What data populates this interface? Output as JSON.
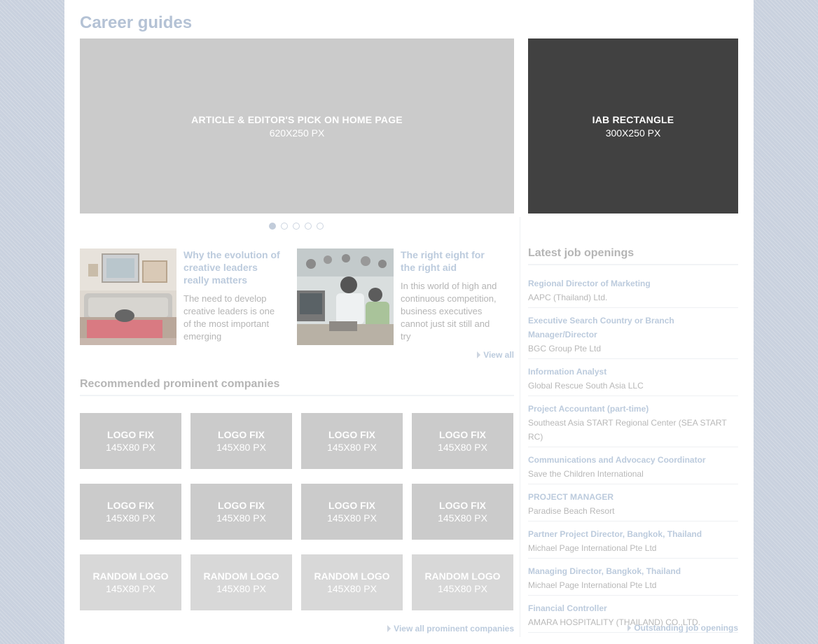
{
  "page": {
    "title": "Career guides"
  },
  "banner": {
    "line1": "ARTICLE & EDITOR'S PICK ON HOME PAGE",
    "line2": "620X250 PX"
  },
  "iab": {
    "line1": "IAB RECTANGLE",
    "line2": "300X250 PX"
  },
  "carousel": {
    "dot_count": 5,
    "active_index": 0
  },
  "articles": [
    {
      "title": "Why the evolution of creative leaders really matters",
      "excerpt": "The need to develop creative leaders is one of the most important emerging"
    },
    {
      "title": "The right eight for the right aid",
      "excerpt": "In this world of high and continuous competition, business executives cannot just sit still and try"
    }
  ],
  "articles_view_all": "View all",
  "recommended": {
    "title": "Recommended prominent companies",
    "logos": [
      {
        "line1": "LOGO FIX",
        "line2": "145X80 PX"
      },
      {
        "line1": "LOGO FIX",
        "line2": "145X80 PX"
      },
      {
        "line1": "LOGO FIX",
        "line2": "145X80 PX"
      },
      {
        "line1": "LOGO FIX",
        "line2": "145X80 PX"
      },
      {
        "line1": "LOGO FIX",
        "line2": "145X80 PX"
      },
      {
        "line1": "LOGO FIX",
        "line2": "145X80 PX"
      },
      {
        "line1": "LOGO FIX",
        "line2": "145X80 PX"
      },
      {
        "line1": "LOGO FIX",
        "line2": "145X80 PX"
      },
      {
        "line1": "RANDOM LOGO",
        "line2": "145X80 PX"
      },
      {
        "line1": "RANDOM LOGO",
        "line2": "145X80 PX"
      },
      {
        "line1": "RANDOM LOGO",
        "line2": "145X80 PX"
      },
      {
        "line1": "RANDOM LOGO",
        "line2": "145X80 PX"
      }
    ],
    "view_all": "View all prominent companies"
  },
  "jobs": {
    "title": "Latest job openings",
    "items": [
      {
        "title": "Regional Director of Marketing",
        "company": "AAPC (Thailand) Ltd."
      },
      {
        "title": "Executive Search Country or Branch Manager/Director",
        "company": "BGC Group Pte Ltd"
      },
      {
        "title": "Information Analyst",
        "company": "Global Rescue South Asia LLC"
      },
      {
        "title": "Project Accountant (part-time)",
        "company": "Southeast Asia START Regional Center (SEA START RC)"
      },
      {
        "title": "Communications and Advocacy Coordinator",
        "company": "Save the Children International"
      },
      {
        "title": "PROJECT MANAGER",
        "company": "Paradise Beach Resort"
      },
      {
        "title": "Partner Project Director, Bangkok, Thailand",
        "company": "Michael Page International Pte Ltd"
      },
      {
        "title": "Managing Director, Bangkok, Thailand",
        "company": "Michael Page International Pte Ltd"
      },
      {
        "title": "Financial Controller",
        "company": "AMARA HOSPITALITY (THAILAND) CO.,LTD."
      }
    ],
    "outstanding": "Outstanding job openings"
  },
  "colors": {
    "accent_text": "#bccbdd",
    "placeholder_gray": "#cbcbcb",
    "iab_dark": "#414141",
    "background": "#c9d1de"
  }
}
